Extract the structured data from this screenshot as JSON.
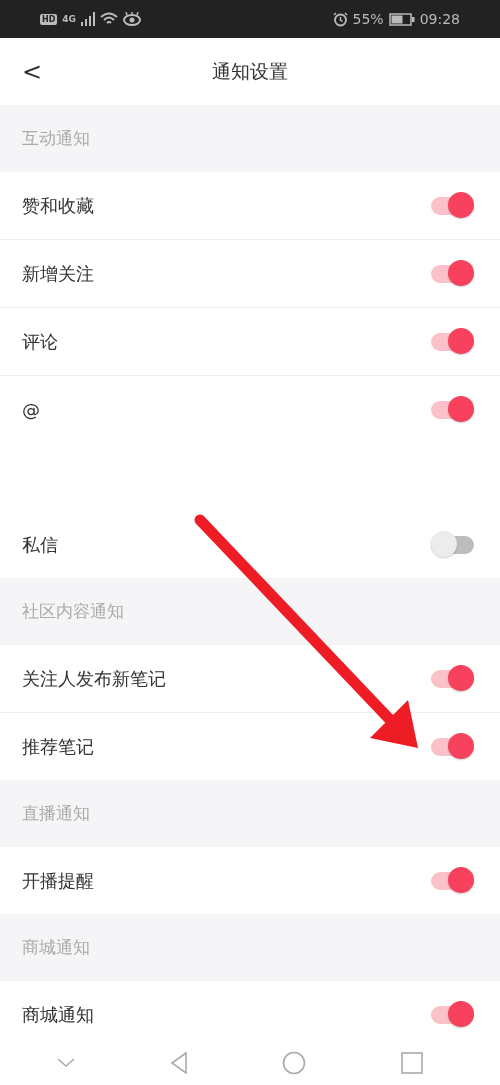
{
  "status_bar": {
    "hd": "HD",
    "network": "4G",
    "battery": "55%",
    "time": "09:28"
  },
  "header": {
    "back": "<",
    "title": "通知设置"
  },
  "sections": [
    {
      "title": "互动通知",
      "items": [
        {
          "kind": "toggle",
          "label": "赞和收藏",
          "on": true
        },
        {
          "kind": "toggle",
          "label": "新增关注",
          "on": true
        },
        {
          "kind": "toggle",
          "label": "评论",
          "on": true
        },
        {
          "kind": "toggle",
          "label": "@",
          "on": true
        },
        {
          "kind": "blank"
        },
        {
          "kind": "toggle",
          "label": "私信",
          "on": false
        }
      ]
    },
    {
      "title": "社区内容通知",
      "items": [
        {
          "kind": "toggle",
          "label": "关注人发布新笔记",
          "on": true
        },
        {
          "kind": "toggle",
          "label": "推荐笔记",
          "on": true
        }
      ]
    },
    {
      "title": "直播通知",
      "items": [
        {
          "kind": "toggle",
          "label": "开播提醒",
          "on": true
        }
      ]
    },
    {
      "title": "商城通知",
      "items": [
        {
          "kind": "toggle",
          "label": "商城通知",
          "on": true
        }
      ]
    }
  ],
  "annotation": {
    "kind": "arrow"
  }
}
